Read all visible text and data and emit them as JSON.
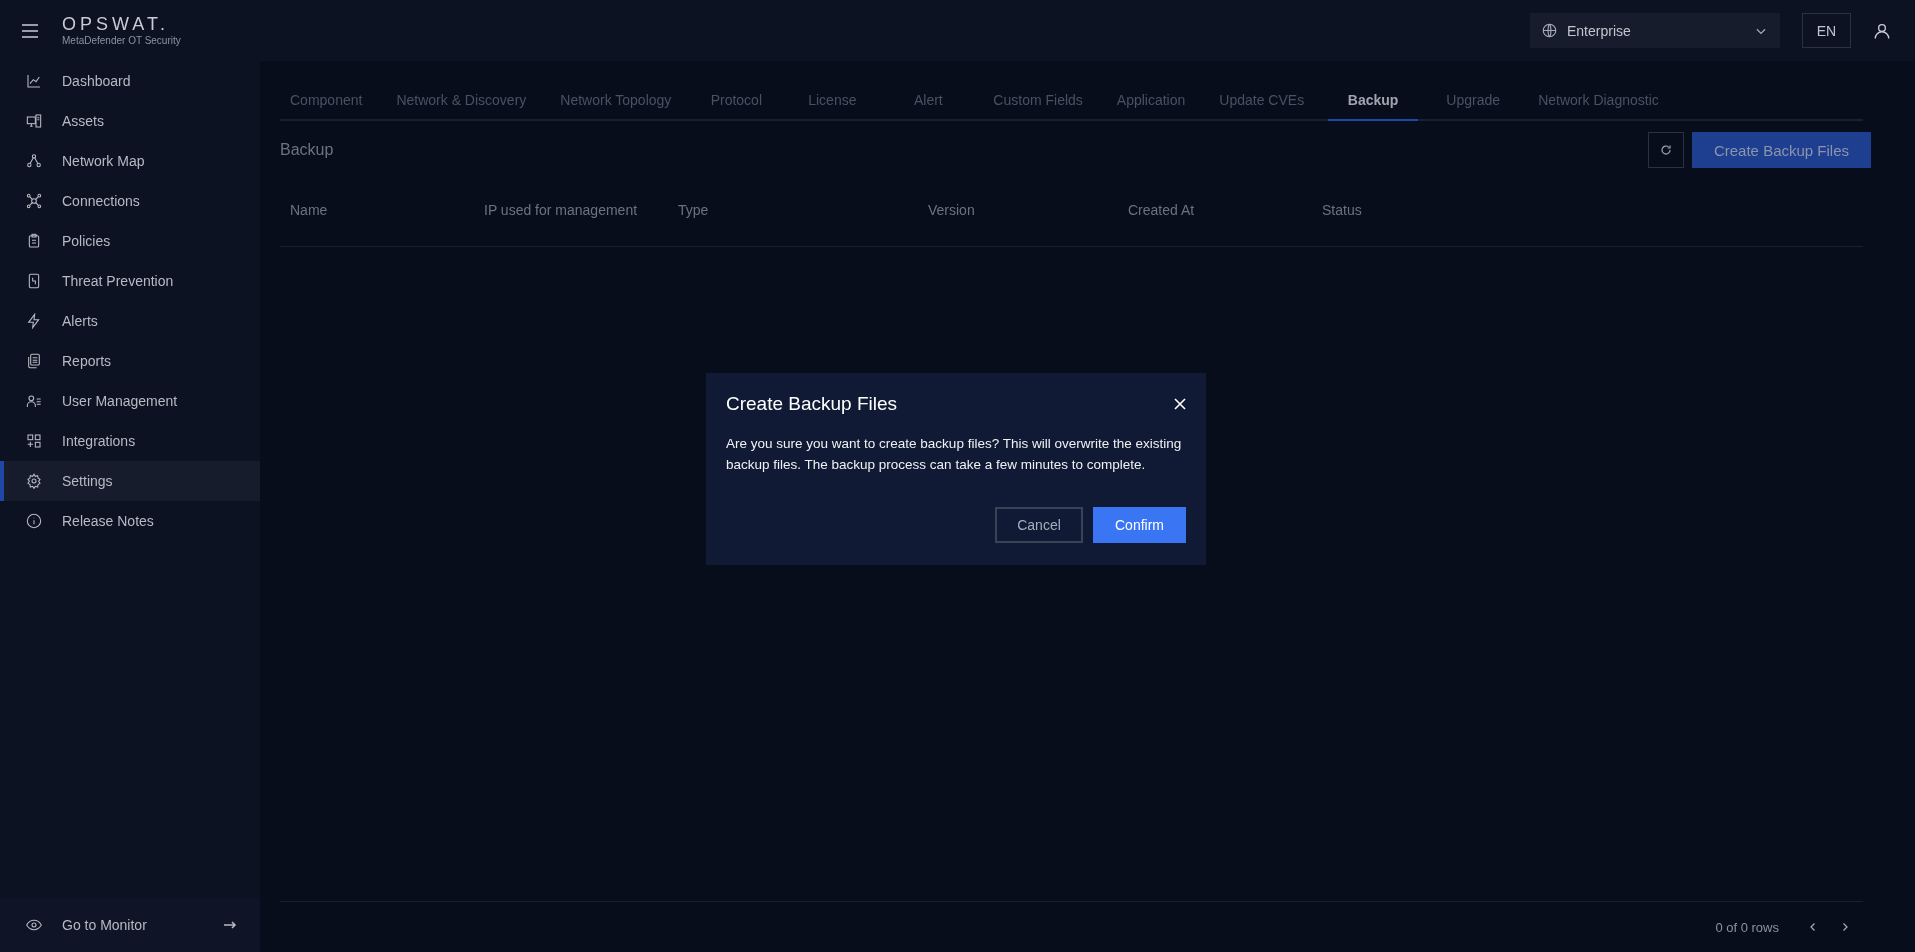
{
  "header": {
    "brand": "OPSWAT.",
    "product": "MetaDefender OT Security",
    "workspace": "Enterprise",
    "language": "EN"
  },
  "sidebar": {
    "items": [
      {
        "label": "Dashboard",
        "selected": false
      },
      {
        "label": "Assets",
        "selected": false
      },
      {
        "label": "Network Map",
        "selected": false
      },
      {
        "label": "Connections",
        "selected": false
      },
      {
        "label": "Policies",
        "selected": false
      },
      {
        "label": "Threat Prevention",
        "selected": false
      },
      {
        "label": "Alerts",
        "selected": false
      },
      {
        "label": "Reports",
        "selected": false
      },
      {
        "label": "User Management",
        "selected": false
      },
      {
        "label": "Integrations",
        "selected": false
      },
      {
        "label": "Settings",
        "selected": true
      },
      {
        "label": "Release Notes",
        "selected": false
      }
    ],
    "footer": "Go to Monitor"
  },
  "tabs": [
    {
      "label": "Component",
      "selected": false
    },
    {
      "label": "Network & Discovery",
      "selected": false
    },
    {
      "label": "Network Topology",
      "selected": false
    },
    {
      "label": "Protocol",
      "selected": false
    },
    {
      "label": "License",
      "selected": false
    },
    {
      "label": "Alert",
      "selected": false
    },
    {
      "label": "Custom Fields",
      "selected": false
    },
    {
      "label": "Application",
      "selected": false
    },
    {
      "label": "Update CVEs",
      "selected": false
    },
    {
      "label": "Backup",
      "selected": true
    },
    {
      "label": "Upgrade",
      "selected": false
    },
    {
      "label": "Network Diagnostic",
      "selected": false
    }
  ],
  "section": {
    "title": "Backup",
    "action": "Create Backup Files"
  },
  "table": {
    "columns": [
      "Name",
      "IP used for management",
      "Type",
      "Version",
      "Created At",
      "Status"
    ],
    "footer": "0 of 0 rows"
  },
  "dialog": {
    "title": "Create Backup Files",
    "message": "Are you sure you want to create backup files? This will overwrite the existing backup files. The backup process can take a few minutes to complete.",
    "buttons": [
      "Cancel",
      "Confirm"
    ]
  }
}
